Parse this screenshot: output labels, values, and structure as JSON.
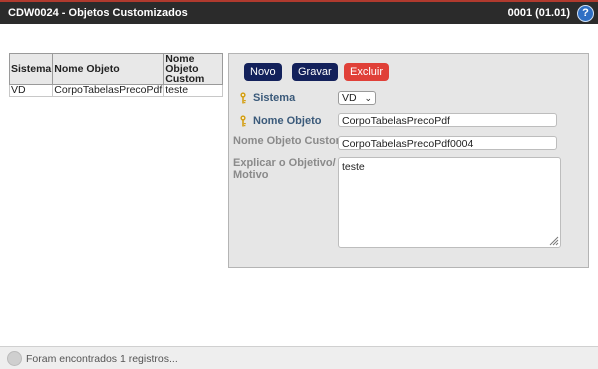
{
  "window": {
    "title": "CDW0024 - Objetos Customizados",
    "version": "0001 (01.01)",
    "help_icon": "?"
  },
  "grid": {
    "headers": [
      "Sistema",
      "Nome Objeto",
      "Nome Objeto Custom"
    ],
    "rows": [
      [
        "VD",
        "CorpoTabelasPrecoPdf",
        "teste"
      ]
    ]
  },
  "toolbar": {
    "novo_label": "Novo",
    "gravar_label": "Gravar",
    "excluir_label": "Excluir"
  },
  "form": {
    "sistema_label": "Sistema",
    "sistema_value": "VD",
    "nome_objeto_label": "Nome Objeto",
    "nome_objeto_value": "CorpoTabelasPrecoPdf",
    "nome_objeto_custom_label": "Nome Objeto Custom",
    "nome_objeto_custom_value": "CorpoTabelasPrecoPdf0004",
    "explicar_label_1": "Explicar o Objetivo/",
    "explicar_label_2": "Motivo",
    "explicar_value": "teste"
  },
  "status": {
    "message": "Foram encontrados 1 registros..."
  },
  "colors": {
    "titlebar": "#2b2b2b",
    "button_dark": "#13215b",
    "button_red": "#e04038",
    "panel": "#e6e6e6",
    "key_icon": "#d4a017"
  }
}
